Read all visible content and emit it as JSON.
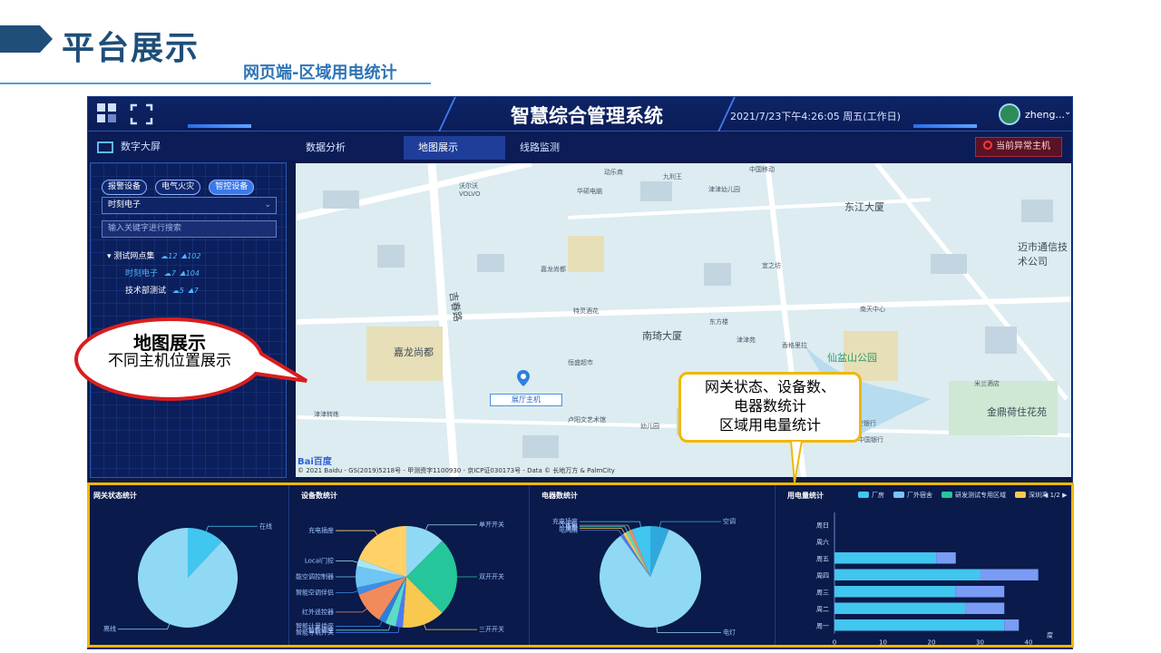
{
  "slide": {
    "title": "平台展示",
    "subtitle": "网页端-区域用电统计"
  },
  "header": {
    "system_title": "智慧综合管理系统",
    "datetime": "2021/7/23下午4:26:05 周五(工作日)",
    "user": "zheng...",
    "icons": [
      "grid-icon",
      "fullscreen-icon",
      "avatar",
      "chevron-down-icon"
    ]
  },
  "nav": {
    "screen_link": "数字大屏",
    "tabs": [
      {
        "label": "数据分析",
        "active": false
      },
      {
        "label": "地图展示",
        "active": true
      },
      {
        "label": "线路监测",
        "active": false
      }
    ],
    "alarm_button": "当前异常主机"
  },
  "sidebar": {
    "chips": [
      {
        "label": "报警设备",
        "active": false
      },
      {
        "label": "电气火灾",
        "active": false
      },
      {
        "label": "智控设备",
        "active": true
      }
    ],
    "select_value": "时刻电子",
    "search_placeholder": "输入关键字进行搜索",
    "tree": [
      {
        "label": "测试网点集",
        "a": "12",
        "b": "102",
        "level": 0
      },
      {
        "label": "时刻电子",
        "a": "7",
        "b": "104",
        "level": 1
      },
      {
        "label": "技术部测试",
        "a": "5",
        "b": "7",
        "level": 1
      }
    ]
  },
  "map": {
    "marker_label": "展厅主机",
    "places": [
      "东江大厦",
      "南琦大厦",
      "嘉龙尚都",
      "仙盆山公园",
      "金鼎荷住花苑",
      "迈市通信技术公司",
      "吉春路"
    ],
    "pois": [
      "沃尔沃",
      "VOLVO",
      "华硕电脑",
      "九利王",
      "津津幼儿园",
      "中国移动",
      "动乐商",
      "嘉龙尚都",
      "恒盛超市",
      "卢阳文艺术馆",
      "津津转练",
      "特灵酒花",
      "幼儿园",
      "南天中心",
      "宜之坊",
      "津津苑",
      "香格里拉",
      "东方楼",
      "平安银行",
      "中国银行",
      "米兰酒店",
      "金鼎荷住花苑"
    ],
    "baidu": "Bai百度",
    "copyright": "© 2021 Baidu - GS(2019)5218号 - 甲测资字1100930 - 京ICP证030173号 - Data © 长地万方 & PalmCity"
  },
  "panels": {
    "gateway": {
      "title": "网关状态统计",
      "labels": [
        "在线",
        "离线"
      ]
    },
    "devices": {
      "title": "设备数统计",
      "labels": [
        "充电插座",
        "Local门控",
        "智能空调控制器",
        "智能空调伴侣",
        "红外遥控器",
        "智能计量插座",
        "智能插座",
        "智能导轨开关",
        "单开开关",
        "双开开关",
        "三开开关"
      ]
    },
    "appliances": {
      "title": "电器数统计",
      "labels": [
        "充电插座",
        "饮水机",
        "插座",
        "风扇",
        "电风扇",
        "空调",
        "电灯"
      ]
    },
    "power": {
      "title": "用电量统计",
      "legend": [
        "厂房",
        "厂外宿舍",
        "研发测试专用区域",
        "深圳湾"
      ],
      "pager": "1/2",
      "unit": "度",
      "x_ticks": [
        "0",
        "10",
        "20",
        "30",
        "40"
      ]
    }
  },
  "chart_data": [
    {
      "type": "pie",
      "title": "网关状态统计",
      "labels": [
        "在线",
        "离线"
      ],
      "values": [
        12,
        88
      ],
      "colors": [
        "#41c6f0",
        "#8fd9f4"
      ]
    },
    {
      "type": "pie",
      "title": "设备数统计",
      "labels": [
        "单开开关",
        "双开开关",
        "三开开关",
        "智能导轨开关",
        "智能插座",
        "智能计量插座",
        "红外遥控器",
        "智能空调伴侣",
        "智能空调控制器",
        "Local门控",
        "充电插座"
      ],
      "values": [
        11,
        22,
        12,
        2,
        3,
        2,
        9,
        2,
        6,
        2,
        17
      ],
      "colors": [
        "#8fd9f4",
        "#25c69a",
        "#f8c84f",
        "#4d7bf3",
        "#5bdcc6",
        "#2e7fd8",
        "#f28b5c",
        "#3d8ee8",
        "#6fc5f3",
        "#a8e6f6",
        "#ffd166"
      ]
    },
    {
      "type": "pie",
      "title": "电器数统计",
      "labels": [
        "空调",
        "电灯",
        "电风扇",
        "风扇",
        "插座",
        "饮水机",
        "充电插座"
      ],
      "values": [
        6,
        84,
        1,
        1,
        1,
        1,
        6
      ],
      "colors": [
        "#2fa9dd",
        "#8fd9f4",
        "#4d7bf3",
        "#f8c84f",
        "#5bdcc6",
        "#f28b5c",
        "#41c6f0"
      ]
    },
    {
      "type": "bar",
      "title": "用电量统计",
      "categories": [
        "周一",
        "周二",
        "周三",
        "周四",
        "周五",
        "周六",
        "周日"
      ],
      "series": [
        {
          "name": "厂房",
          "values": [
            35,
            27,
            25,
            30,
            21,
            0,
            0
          ]
        },
        {
          "name": "厂外宿舍",
          "values": [
            3,
            8,
            10,
            12,
            4,
            0,
            0
          ]
        }
      ],
      "xlim": [
        0,
        40
      ],
      "unit": "度"
    }
  ],
  "callouts": {
    "oval_title": "地图展示",
    "oval_text": "不同主机位置展示",
    "box_text": [
      "网关状态、设备数、",
      "电器数统计",
      "区域用电量统计"
    ]
  }
}
